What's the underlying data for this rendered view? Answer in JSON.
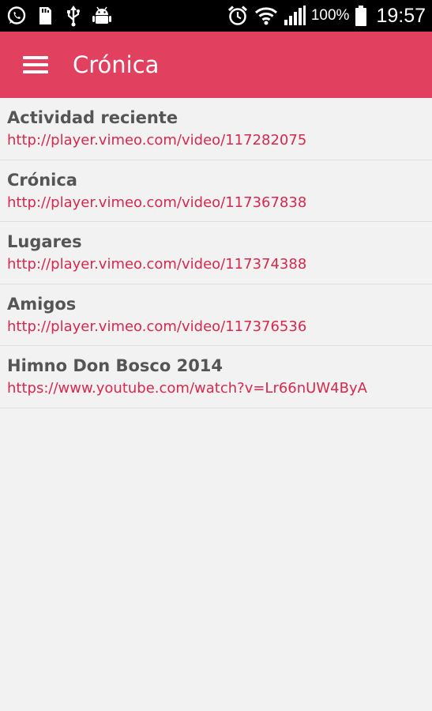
{
  "status_bar": {
    "battery_percent": "100%",
    "time": "19:57",
    "icons_left": [
      "whatsapp-icon",
      "sd-card-icon",
      "usb-icon",
      "android-icon"
    ],
    "icons_right": [
      "alarm-icon",
      "wifi-icon",
      "signal-icon",
      "battery-icon"
    ]
  },
  "app_bar": {
    "title": "Crónica",
    "menu_icon": "hamburger-menu-icon",
    "color": "#e1405f"
  },
  "items": [
    {
      "title": "Actividad reciente",
      "link": "http://player.vimeo.com/video/117282075"
    },
    {
      "title": "Crónica",
      "link": "http://player.vimeo.com/video/117367838"
    },
    {
      "title": "Lugares",
      "link": "http://player.vimeo.com/video/117374388"
    },
    {
      "title": "Amigos",
      "link": "http://player.vimeo.com/video/117376536"
    },
    {
      "title": "Himno Don Bosco 2014",
      "link": "https://www.youtube.com/watch?v=Lr66nUW4ByA"
    }
  ],
  "colors": {
    "link": "#d8284e",
    "title": "#555555",
    "background": "#f2f2f2"
  }
}
